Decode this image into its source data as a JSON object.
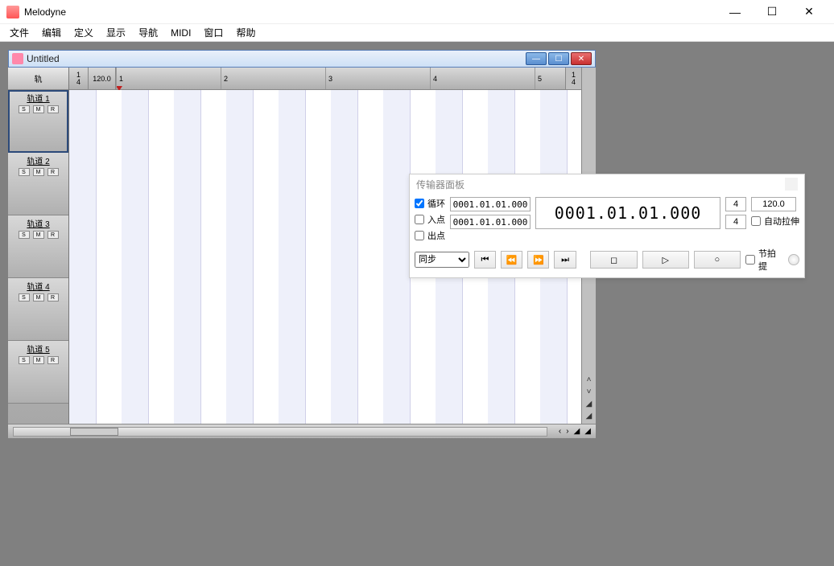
{
  "app": {
    "title": "Melodyne"
  },
  "menu": [
    "文件",
    "编辑",
    "定义",
    "显示",
    "导航",
    "MIDI",
    "窗口",
    "帮助"
  ],
  "doc": {
    "title": "Untitled",
    "timesig_top": "1",
    "timesig_bot": "4",
    "tempo": "120.0",
    "bars": [
      "1",
      "2",
      "3",
      "4",
      "5"
    ],
    "timesig2_top": "1",
    "timesig2_bot": "4",
    "track_header": "轨",
    "tracks": [
      {
        "name": "轨道 1",
        "s": "S",
        "m": "M",
        "r": "R",
        "selected": true
      },
      {
        "name": "轨道 2",
        "s": "S",
        "m": "M",
        "r": "R",
        "selected": false
      },
      {
        "name": "轨道 3",
        "s": "S",
        "m": "M",
        "r": "R",
        "selected": false
      },
      {
        "name": "轨道 4",
        "s": "S",
        "m": "M",
        "r": "R",
        "selected": false
      },
      {
        "name": "轨道 5",
        "s": "S",
        "m": "M",
        "r": "R",
        "selected": false
      }
    ]
  },
  "transport": {
    "title": "传输器面板",
    "loop_label": "循环",
    "in_label": "入点",
    "out_label": "出点",
    "loop_checked": true,
    "in_checked": false,
    "out_checked": false,
    "tc1": "0001.01.01.000",
    "tc2": "0001.01.01.000",
    "bigtc": "0001.01.01.000",
    "sig_top": "4",
    "sig_bot": "4",
    "tempo": "120.0",
    "autostretch_label": "自动拉伸",
    "sync_label": "同步",
    "metronome_label": "节拍提"
  },
  "glyphs": {
    "min": "—",
    "max": "☐",
    "close": "✕",
    "skip_start": "⏮",
    "rewind": "⏪",
    "forward": "⏩",
    "skip_end": "⏭",
    "stop": "◻",
    "play": "▷",
    "rec": "○",
    "left": "‹",
    "right": "›",
    "zoom": "▲"
  }
}
